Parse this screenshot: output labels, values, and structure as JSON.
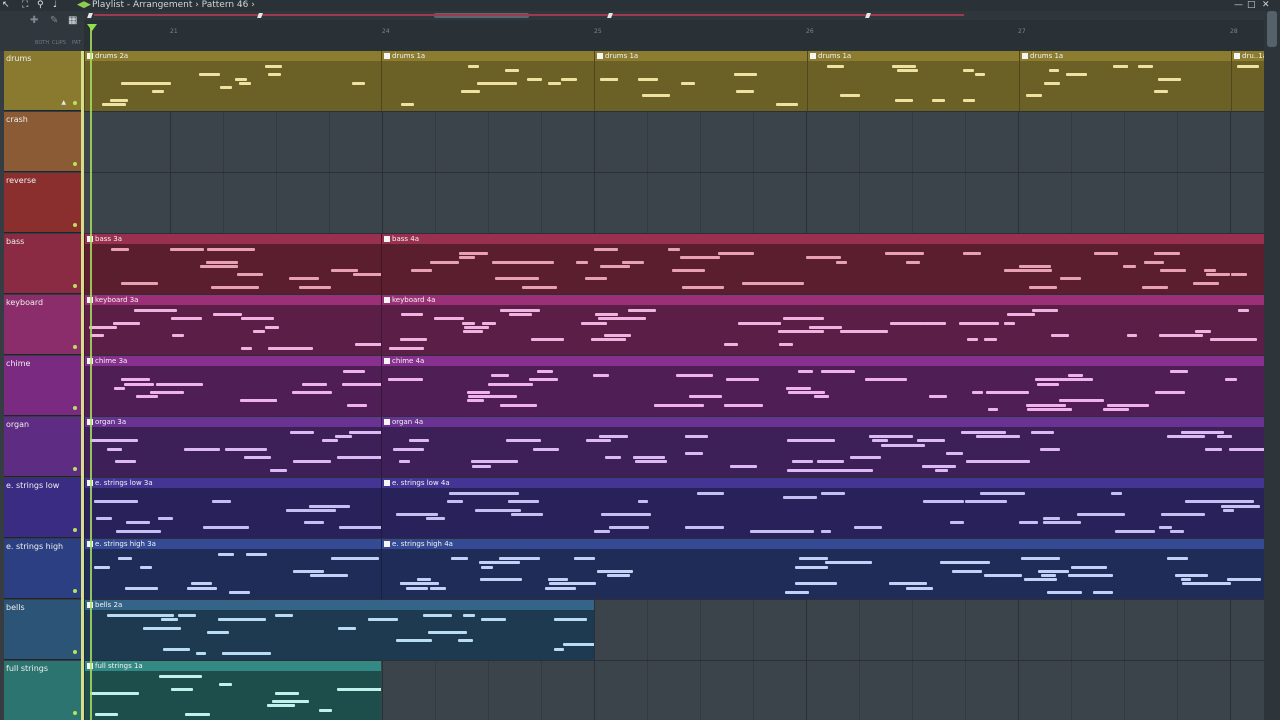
{
  "titlebar": {
    "title": "Playlist - Arrangement › Pattern 46 ›",
    "icons": [
      "pointer-icon",
      "loop-icon",
      "magnifier-icon",
      "speaker-icon"
    ],
    "window_buttons": [
      "minimize-icon",
      "maximize-icon",
      "close-icon"
    ]
  },
  "toolbar": {
    "mini_labels": [
      "BOTH",
      "CLIPS",
      "PAT"
    ]
  },
  "ruler": {
    "bar_labels": [
      "21",
      "24",
      "25",
      "26",
      "27",
      "28"
    ]
  },
  "tracks": [
    {
      "name": "drums",
      "color": "#6e6326",
      "head_color": "#8a7a2f",
      "clip_color": "#6b6126",
      "clip_head_color": "#8c7c30",
      "note_color": "#efe2a0",
      "clips": [
        {
          "label": "drums 2a",
          "start": 0,
          "len": 297
        },
        {
          "label": "drums 1a",
          "start": 297,
          "len": 213
        },
        {
          "label": "drums 1a",
          "start": 510,
          "len": 213
        },
        {
          "label": "drums 1a",
          "start": 723,
          "len": 212
        },
        {
          "label": "drums 1a",
          "start": 935,
          "len": 212
        },
        {
          "label": "dru..1a",
          "start": 1147,
          "len": 33
        }
      ]
    },
    {
      "name": "crash",
      "head_color": "#8a5b34",
      "clips": []
    },
    {
      "name": "reverse",
      "head_color": "#8a2f2e",
      "clips": []
    },
    {
      "name": "bass",
      "head_color": "#8a2a43",
      "clip_color": "#5a1e2e",
      "clip_head_color": "#9a3050",
      "note_color": "#e8a0b4",
      "clips": [
        {
          "label": "bass 3a",
          "start": 0,
          "len": 297
        },
        {
          "label": "bass 4a",
          "start": 297,
          "len": 883
        }
      ]
    },
    {
      "name": "keyboard",
      "head_color": "#8a2d6a",
      "clip_color": "#5a1e47",
      "clip_head_color": "#9c3078",
      "note_color": "#f0b2e0",
      "clips": [
        {
          "label": "keyboard 3a",
          "start": 0,
          "len": 297
        },
        {
          "label": "keyboard 4a",
          "start": 297,
          "len": 883
        }
      ]
    },
    {
      "name": "chime",
      "head_color": "#7a2a80",
      "clip_color": "#4e1e55",
      "clip_head_color": "#883090",
      "note_color": "#f0b2ea",
      "clips": [
        {
          "label": "chime 3a",
          "start": 0,
          "len": 297
        },
        {
          "label": "chime 4a",
          "start": 297,
          "len": 883
        }
      ]
    },
    {
      "name": "organ",
      "head_color": "#5e2c82",
      "clip_color": "#3e2058",
      "clip_head_color": "#6a3292",
      "note_color": "#dcb8f4",
      "clips": [
        {
          "label": "organ 3a",
          "start": 0,
          "len": 297
        },
        {
          "label": "organ 4a",
          "start": 297,
          "len": 883
        }
      ]
    },
    {
      "name": "e. strings low",
      "head_color": "#3a2c82",
      "clip_color": "#28215a",
      "clip_head_color": "#443494",
      "note_color": "#c4c0f4",
      "clips": [
        {
          "label": "e. strings low 3a",
          "start": 0,
          "len": 297
        },
        {
          "label": "e. strings low 4a",
          "start": 297,
          "len": 883
        }
      ]
    },
    {
      "name": "e. strings high",
      "head_color": "#2c3f82",
      "clip_color": "#1f2c58",
      "clip_head_color": "#344a94",
      "note_color": "#c2d2f6",
      "clips": [
        {
          "label": "e. strings high 3a",
          "start": 0,
          "len": 297
        },
        {
          "label": "e. strings high 4a",
          "start": 297,
          "len": 883
        }
      ]
    },
    {
      "name": "bells",
      "head_color": "#2c5476",
      "clip_color": "#1e3a50",
      "clip_head_color": "#346488",
      "note_color": "#b8dcf2",
      "clips": [
        {
          "label": "bells 2a",
          "start": 0,
          "len": 510
        }
      ]
    },
    {
      "name": "full strings",
      "head_color": "#2c7470",
      "clip_color": "#1e4e4c",
      "clip_head_color": "#338a84",
      "note_color": "#bff2ea",
      "clips": [
        {
          "label": "full strings 1a",
          "start": 0,
          "len": 297
        }
      ]
    }
  ]
}
